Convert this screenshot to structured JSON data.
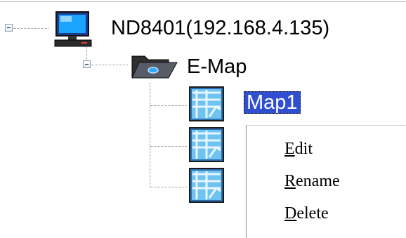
{
  "tree": {
    "root": {
      "label": "ND8401(192.168.4.135)",
      "icon": "computer-icon",
      "expanded": true
    },
    "emap": {
      "label": "E-Map",
      "icon": "folder-icon",
      "expanded": true
    },
    "maps": [
      {
        "label": "Map1",
        "icon": "map-icon",
        "selected": true
      },
      {
        "label": "",
        "icon": "map-icon"
      },
      {
        "label": "",
        "icon": "map-icon"
      }
    ]
  },
  "context_menu": {
    "items": [
      {
        "accel": "E",
        "rest": "dit"
      },
      {
        "accel": "R",
        "rest": "ename"
      },
      {
        "accel": "D",
        "rest": "elete"
      }
    ]
  },
  "colors": {
    "selection": "#2f4fd0",
    "map_icon": "#3d8fd6"
  }
}
